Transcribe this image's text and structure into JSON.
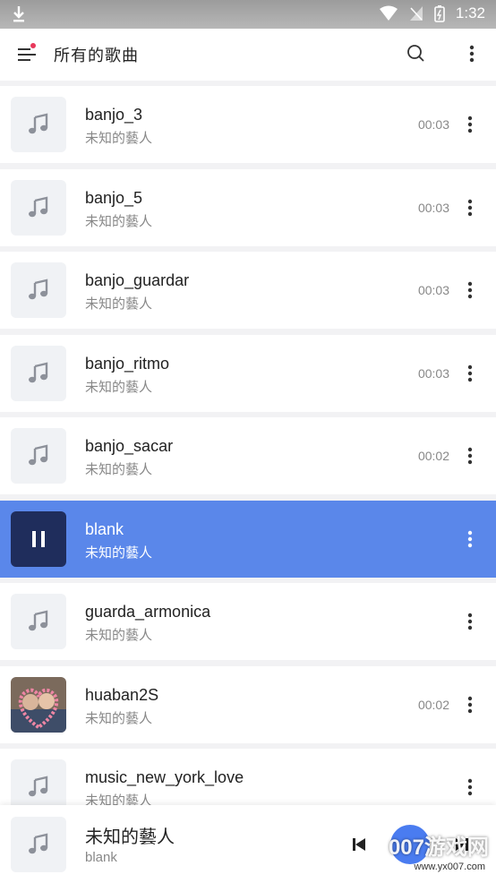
{
  "status": {
    "time": "1:32"
  },
  "toolbar": {
    "title": "所有的歌曲"
  },
  "songs": [
    {
      "name": "banjo_3",
      "artist": "未知的藝人",
      "duration": "00:03",
      "art": "music-note-icon",
      "active": false
    },
    {
      "name": "banjo_5",
      "artist": "未知的藝人",
      "duration": "00:03",
      "art": "music-note-icon",
      "active": false
    },
    {
      "name": "banjo_guardar",
      "artist": "未知的藝人",
      "duration": "00:03",
      "art": "music-note-icon",
      "active": false
    },
    {
      "name": "banjo_ritmo",
      "artist": "未知的藝人",
      "duration": "00:03",
      "art": "music-note-icon",
      "active": false
    },
    {
      "name": "banjo_sacar",
      "artist": "未知的藝人",
      "duration": "00:02",
      "art": "music-note-icon",
      "active": false
    },
    {
      "name": "blank",
      "artist": "未知的藝人",
      "duration": "",
      "art": "pause-icon",
      "active": true
    },
    {
      "name": "guarda_armonica",
      "artist": "未知的藝人",
      "duration": "",
      "art": "music-note-icon",
      "active": false
    },
    {
      "name": "huaban2S",
      "artist": "未知的藝人",
      "duration": "00:02",
      "art": "album-photo",
      "active": false
    },
    {
      "name": "music_new_york_love",
      "artist": "未知的藝人",
      "duration": "",
      "art": "music-note-icon",
      "active": false
    }
  ],
  "player": {
    "title": "未知的藝人",
    "subtitle": "blank"
  },
  "watermark": {
    "brand": "007游戏网",
    "url": "www.yx007.com"
  },
  "colors": {
    "accent": "#5a87ea",
    "active_thumb": "#1f2d5c",
    "badge": "#e8385b",
    "play_button": "#4a7cf0"
  }
}
